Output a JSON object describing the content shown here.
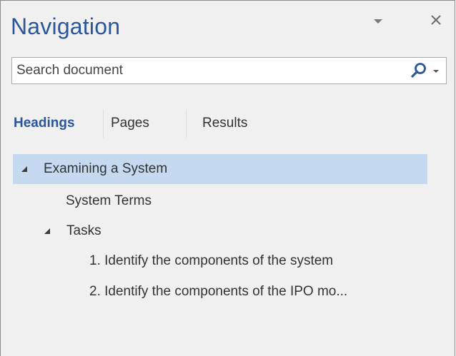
{
  "pane": {
    "title": "Navigation",
    "options_icon": "chevron-down-icon",
    "close_icon": "close-icon",
    "close_glyph": "✕"
  },
  "search": {
    "placeholder": "Search document",
    "value": "",
    "search_icon": "magnifier-icon",
    "dropdown_icon": "chevron-down-icon"
  },
  "tabs": [
    {
      "label": "Headings",
      "active": true
    },
    {
      "label": "Pages",
      "active": false
    },
    {
      "label": "Results",
      "active": false
    }
  ],
  "headings": [
    {
      "label": "Examining a System",
      "level": 1,
      "expanded": true,
      "selected": true
    },
    {
      "label": "System Terms",
      "level": 2,
      "expanded": null,
      "selected": false
    },
    {
      "label": "Tasks",
      "level": 2,
      "expanded": true,
      "selected": false
    },
    {
      "label": "1. Identify the components of the system",
      "level": 3,
      "expanded": null,
      "selected": false
    },
    {
      "label": "2. Identify the components of the IPO mo...",
      "level": 3,
      "expanded": null,
      "selected": false
    }
  ],
  "colors": {
    "accent": "#2b579a",
    "selection": "#c5daf1",
    "pane_background": "#f0f0f0"
  }
}
